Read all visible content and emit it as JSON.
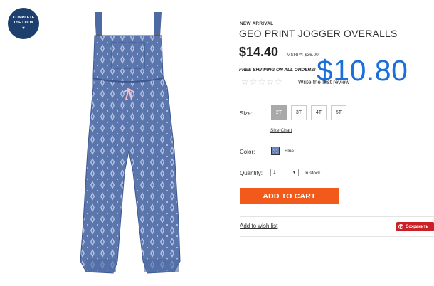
{
  "complete_look": {
    "line1": "COMPLETE",
    "line2": "THE LOOK",
    "chevron": "▾"
  },
  "product": {
    "badge": "NEW ARRIVAL",
    "title": "GEO PRINT JOGGER OVERALLS",
    "price": "$14.40",
    "msrp": "MSRP*: $36.00",
    "shipping": "FREE SHIPPING ON ALL ORDERS!",
    "overlay_price": "$10.80",
    "rating_stars": "☆☆☆☆☆",
    "review_link": "Write the first review"
  },
  "size": {
    "label": "Size:",
    "options": [
      "2T",
      "3T",
      "4T",
      "5T"
    ],
    "selected": "2T",
    "chart_link": "Size Chart"
  },
  "color": {
    "label": "Color:",
    "value": "Blue",
    "swatch_hex": "#6a86bd"
  },
  "quantity": {
    "label": "Quantity:",
    "value": "1",
    "stock": "In stock"
  },
  "actions": {
    "add_to_cart": "ADD TO CART",
    "wishlist": "Add to wish list",
    "save": "Сохранить"
  },
  "colors": {
    "accent": "#f25a1b",
    "navy": "#1c3f6e",
    "overlay_blue": "#1a6fd8",
    "pinterest_red": "#cb2027"
  }
}
